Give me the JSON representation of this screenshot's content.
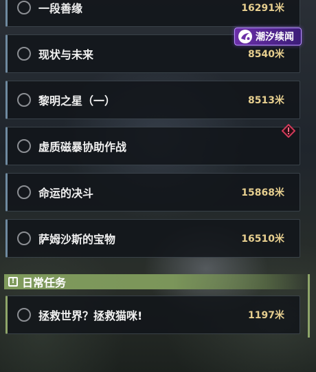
{
  "quests": [
    {
      "title": "一段善缘",
      "distance": "16291米"
    },
    {
      "title": "现状与未来",
      "distance": "8540米"
    },
    {
      "title": "黎明之星（一）",
      "distance": "8513米"
    },
    {
      "title": "虚质磁暴协助作战",
      "distance": ""
    },
    {
      "title": "命运的决斗",
      "distance": "15868米"
    },
    {
      "title": "萨姆沙斯的宝物",
      "distance": "16510米"
    }
  ],
  "tide_badge": {
    "label": "潮汐续闻",
    "color": "#6b2fa8"
  },
  "daily_section": {
    "label": "日常任务",
    "icon": "info-box-icon",
    "tasks": [
      {
        "title": "拯救世界？拯救猫咪!",
        "distance": "1197米"
      }
    ]
  },
  "colors": {
    "distance": "#e7cf8f",
    "accent_blue": "#6f8aa0",
    "accent_green": "#8fa66a",
    "alert": "#d23a5a"
  }
}
